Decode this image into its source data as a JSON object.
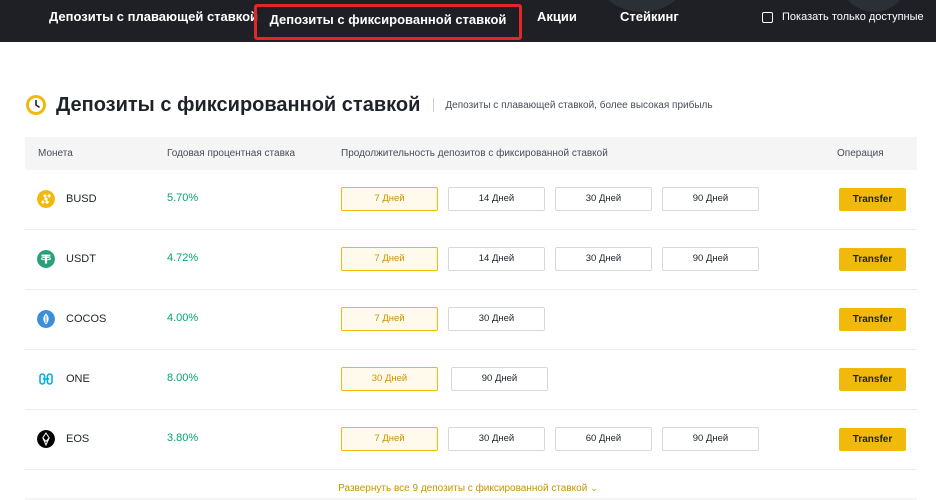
{
  "nav": {
    "tabs": [
      {
        "label": "Депозиты с плавающей ставкой"
      },
      {
        "label": "Депозиты с фиксированной ставкой"
      },
      {
        "label": "Акции"
      },
      {
        "label": "Стейкинг"
      }
    ],
    "selected_tab": "Депозиты с фиксированной ставкой",
    "show_available_label": "Показать только доступные",
    "show_available_checked": false
  },
  "section": {
    "title": "Депозиты с фиксированной ставкой",
    "subtitle": "Депозиты с плавающей ставкой, более высокая прибыль",
    "icon": "clock-icon"
  },
  "table": {
    "headers": {
      "coin": "Монета",
      "apy": "Годовая процентная ставка",
      "duration": "Продолжительность депозитов с фиксированной ставкой",
      "operation": "Операция"
    },
    "rows": [
      {
        "coin": "BUSD",
        "icon": "busd-icon",
        "apy": "5.70%",
        "durations": [
          "7 Дней",
          "14 Дней",
          "30 Дней",
          "90 Дней"
        ],
        "selected": "7 Дней",
        "action": "Transfer"
      },
      {
        "coin": "USDT",
        "icon": "usdt-icon",
        "apy": "4.72%",
        "durations": [
          "7 Дней",
          "14 Дней",
          "30 Дней",
          "90 Дней"
        ],
        "selected": "7 Дней",
        "action": "Transfer"
      },
      {
        "coin": "COCOS",
        "icon": "cocos-icon",
        "apy": "4.00%",
        "durations": [
          "7 Дней",
          "30 Дней"
        ],
        "selected": "7 Дней",
        "action": "Transfer"
      },
      {
        "coin": "ONE",
        "icon": "one-icon",
        "apy": "8.00%",
        "durations": [
          "30 Дней",
          "90 Дней"
        ],
        "selected": "30 Дней",
        "action": "Transfer"
      },
      {
        "coin": "EOS",
        "icon": "eos-icon",
        "apy": "3.80%",
        "durations": [
          "7 Дней",
          "30 Дней",
          "60 Дней",
          "90 Дней"
        ],
        "selected": "7 Дней",
        "action": "Transfer"
      }
    ],
    "expand_label": "Развернуть все 9 депозиты с фиксированной ставкой"
  },
  "colors": {
    "nav_bg": "#1e2026",
    "accent": "#f0b90b",
    "accent_text": "#c99400",
    "positive": "#03a66d",
    "highlight_border": "#e6252a"
  }
}
